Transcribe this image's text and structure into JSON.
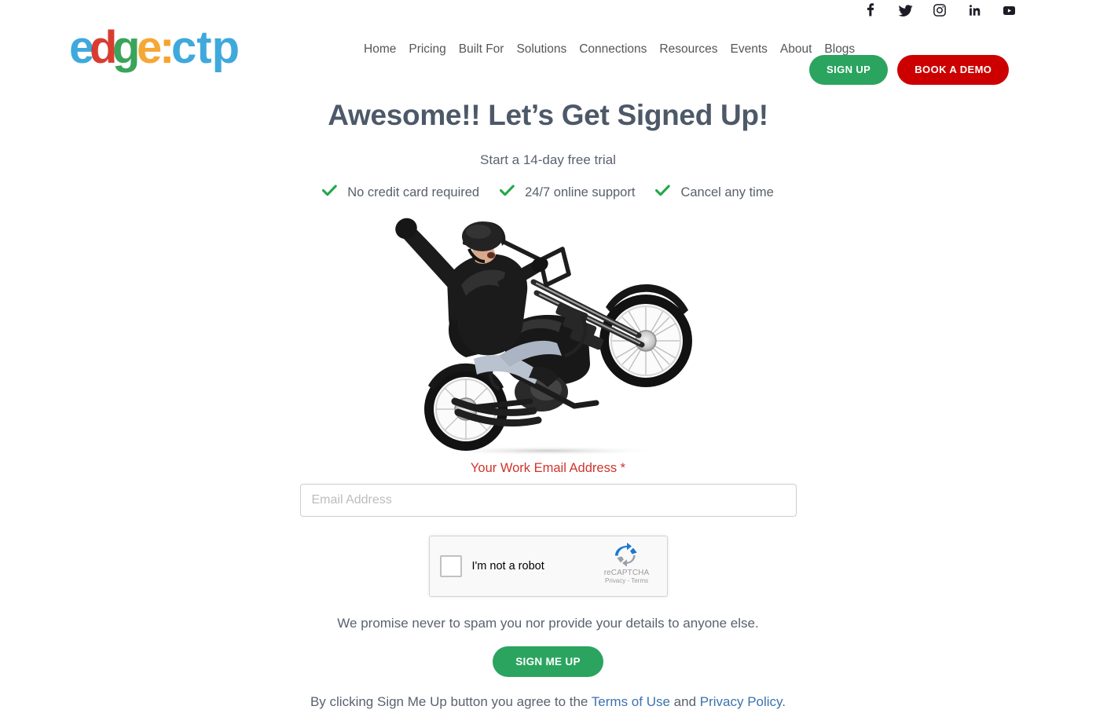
{
  "social": {
    "items": [
      {
        "name": "facebook",
        "icon": "facebook-icon",
        "label": "f"
      },
      {
        "name": "twitter",
        "icon": "twitter-icon",
        "label": "Twitter"
      },
      {
        "name": "instagram",
        "icon": "instagram-icon",
        "label": "Instagram"
      },
      {
        "name": "linkedin",
        "icon": "linkedin-icon",
        "label": "in"
      },
      {
        "name": "youtube",
        "icon": "youtube-icon",
        "label": "YouTube"
      }
    ]
  },
  "logo": {
    "text": "edge:ctp",
    "parts": [
      "e",
      "d",
      "g",
      "e",
      ":",
      "ctp"
    ],
    "colors": {
      "e1": "#3fa9dc",
      "d": "#d62d20",
      "g": "#2a9d4e",
      "e2": "#f5a42b",
      "colon": "#f5a42b",
      "ctp": "#3fa9dc"
    }
  },
  "nav": {
    "items": [
      {
        "label": "Home"
      },
      {
        "label": "Pricing"
      },
      {
        "label": "Built For"
      },
      {
        "label": "Solutions"
      },
      {
        "label": "Connections"
      },
      {
        "label": "Resources"
      },
      {
        "label": "Events"
      },
      {
        "label": "About"
      },
      {
        "label": "Blogs"
      }
    ],
    "signup_label": "SIGN UP",
    "demo_label": "BOOK A DEMO",
    "signup_color": "#2aa45f",
    "demo_color": "#cc0000"
  },
  "main": {
    "headline": "Awesome!! Let’s Get Signed Up!",
    "subhead": "Start a 14-day free trial",
    "headline_color": "#4d5968",
    "benefits": [
      {
        "label": "No credit card required"
      },
      {
        "label": "24/7 online support"
      },
      {
        "label": "Cancel any time"
      }
    ],
    "benefit_check_color": "#22a84c",
    "hero_alt": "Man doing a wheelie on a black chopper motorcycle with arm raised"
  },
  "form": {
    "email_label": "Your Work Email Address",
    "email_required_mark": "*",
    "email_label_color": "#d0342c",
    "email_value": "",
    "email_placeholder": "Email Address",
    "recaptcha": {
      "checkbox_label": "I'm not a robot",
      "brand": "reCAPTCHA",
      "privacy": "Privacy",
      "separator": "-",
      "terms": "Terms",
      "checked": false
    },
    "promise": "We promise never to spam you nor provide your details to anyone else.",
    "submit_label": "SIGN ME UP",
    "submit_color": "#2aa45f",
    "agree_prefix": "By clicking Sign Me Up button you agree to the ",
    "agree_terms_link": "Terms of Use",
    "agree_mid": " and ",
    "agree_privacy_link": "Privacy Policy",
    "agree_suffix": ".",
    "link_color": "#3b73af"
  }
}
